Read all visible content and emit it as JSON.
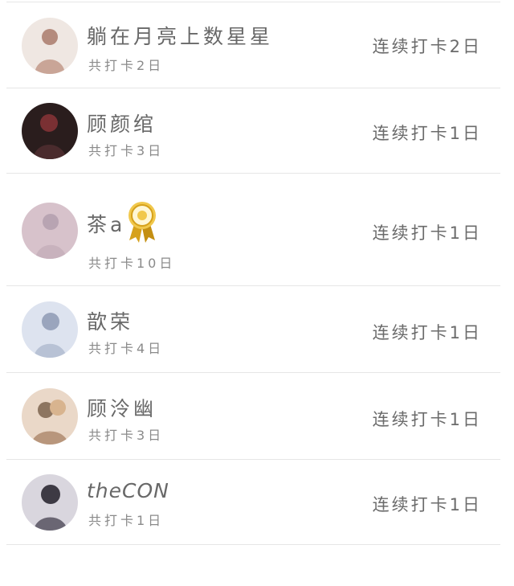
{
  "members": [
    {
      "name": "躺在月亮上数星星",
      "total": "共打卡2日",
      "streak": "连续打卡2日",
      "medal": false,
      "avatar_icon": "user-avatar",
      "avatar_colors": [
        "#efe7e2",
        "#b48b7d"
      ]
    },
    {
      "name": "顾颜绾",
      "total": "共打卡3日",
      "streak": "连续打卡1日",
      "medal": false,
      "avatar_icon": "user-avatar",
      "avatar_colors": [
        "#2a1d1d",
        "#7a3033"
      ]
    },
    {
      "name": "茶a",
      "total": "共打卡10日",
      "streak": "连续打卡1日",
      "medal": true,
      "medal_icon": "gold-medal-icon",
      "avatar_icon": "user-avatar",
      "avatar_colors": [
        "#d7c2cb",
        "#b8a4b2"
      ]
    },
    {
      "name": "歆荣",
      "total": "共打卡4日",
      "streak": "连续打卡1日",
      "medal": false,
      "avatar_icon": "user-avatar",
      "avatar_colors": [
        "#dde3ef",
        "#9aa5bd"
      ]
    },
    {
      "name": "顾泠幽",
      "total": "共打卡3日",
      "streak": "连续打卡1日",
      "medal": false,
      "avatar_icon": "user-avatar",
      "avatar_colors": [
        "#ead8c8",
        "#8d7560"
      ]
    },
    {
      "name": "theCON",
      "total": "共打卡1日",
      "streak": "连续打卡1日",
      "medal": false,
      "avatar_icon": "user-avatar",
      "avatar_colors": [
        "#d9d6de",
        "#3d3a44"
      ]
    }
  ],
  "colors": {
    "text_primary": "#686868",
    "text_secondary": "#8a8a8a",
    "divider": "#e6e6e6",
    "medal_gold": "#d6a11b"
  }
}
